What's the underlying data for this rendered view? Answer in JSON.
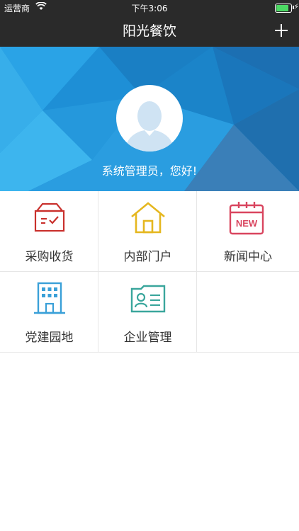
{
  "status_bar": {
    "carrier": "运营商",
    "time": "下午3:06"
  },
  "nav": {
    "title": "阳光餐饮",
    "add_icon": "plus-icon"
  },
  "profile": {
    "greeting": "系统管理员，您好!"
  },
  "menu": [
    {
      "label": "采购收货",
      "icon": "purchase-receipt-icon",
      "color": "#c9302c"
    },
    {
      "label": "内部门户",
      "icon": "home-icon",
      "color": "#e5b71f"
    },
    {
      "label": "新闻中心",
      "icon": "news-calendar-icon",
      "color": "#d9455f"
    },
    {
      "label": "党建园地",
      "icon": "building-icon",
      "color": "#3aa0d8"
    },
    {
      "label": "企业管理",
      "icon": "contact-card-icon",
      "color": "#3aa69c"
    }
  ]
}
